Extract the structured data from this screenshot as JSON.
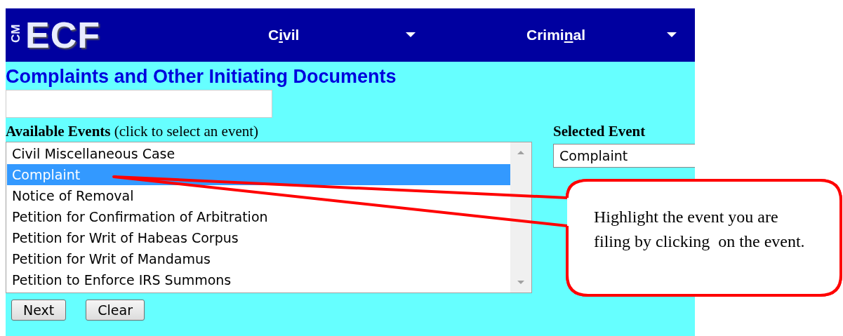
{
  "logo": {
    "side": "CM",
    "main": "ECF"
  },
  "menu": [
    {
      "parts": [
        "C",
        "i",
        "vil"
      ]
    },
    {
      "parts": [
        "Crimi",
        "n",
        "al"
      ]
    }
  ],
  "page_title": "Complaints and Other Initiating Documents",
  "available_events": {
    "label": "Available Events",
    "hint": "(click to select an event)",
    "items": [
      {
        "label": "Civil Miscellaneous Case",
        "selected": false
      },
      {
        "label": "Complaint",
        "selected": true
      },
      {
        "label": "Notice of Removal",
        "selected": false
      },
      {
        "label": "Petition for Confirmation of Arbitration",
        "selected": false
      },
      {
        "label": "Petition for Writ of Habeas Corpus",
        "selected": false
      },
      {
        "label": "Petition for Writ of Mandamus",
        "selected": false
      },
      {
        "label": "Petition to Enforce IRS Summons",
        "selected": false
      }
    ]
  },
  "selected_event": {
    "label": "Selected Event",
    "value": "Complaint"
  },
  "buttons": [
    "Next",
    "Clear"
  ],
  "callout": {
    "text": "Highlight the event you are filing by clicking  on the event."
  }
}
